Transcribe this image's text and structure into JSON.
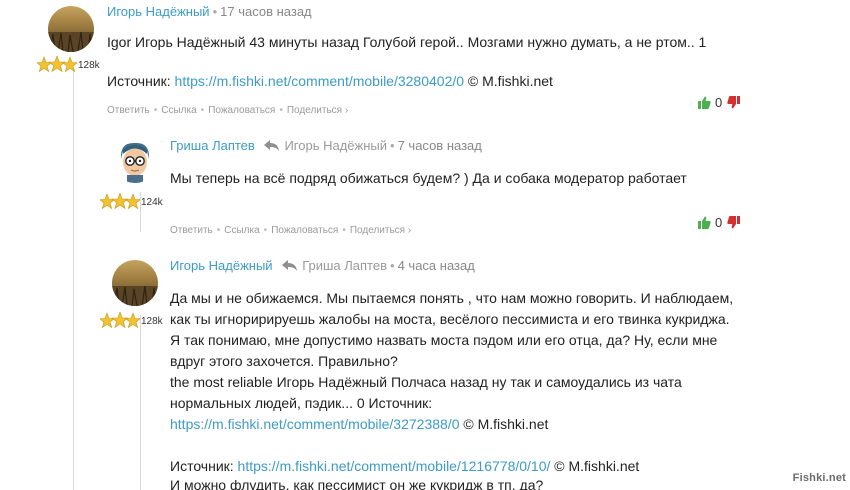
{
  "comments": [
    {
      "author": "Игорь Надёжный",
      "reply_to": "",
      "time": "17 часов назад",
      "karma": "128k",
      "lines": [
        "Igor Игорь Надёжный 43 минуты назад Голубой герой.. Мозгами нужно думать, а не ртом.. 1"
      ],
      "source_label": "Источник:",
      "source_url": "https://m.fishki.net/comment/mobile/3280402/0",
      "source_suffix": "© M.fishki.net",
      "actions": [
        "Ответить",
        "Ссылка",
        "Пожаловаться",
        "Поделиться ›"
      ],
      "score": "0"
    },
    {
      "author": "Гриша Лаптев",
      "reply_to": "Игорь Надёжный",
      "time": "7 часов назад",
      "karma": "124k",
      "lines": [
        "Мы теперь на всё подряд обижаться будем? ) Да и собака модератор работает"
      ],
      "actions": [
        "Ответить",
        "Ссылка",
        "Пожаловаться",
        "Поделиться ›"
      ],
      "score": "0"
    },
    {
      "author": "Игорь Надёжный",
      "reply_to": "Гриша Лаптев",
      "time": "4 часа назад",
      "karma": "128k",
      "lines": [
        "Да мы и не обижаемся. Мы пытаемся понять , что нам можно говорить. И наблюдаем,",
        "как ты игноририруешь жалобы на моста, весёлого пессимиста и его твинка кукриджа.",
        "Я так понимаю, мне допустимо назвать моста пэдом или его отца, да? Ну, если мне",
        "вдруг этого захочется. Правильно?",
        "the most reliable Игорь Надёжный Полчаса назад ну так и самоудались из чата",
        "нормальных людей, пэдик... 0 Источник:"
      ],
      "link1_url": "https://m.fishki.net/comment/mobile/3272388/0",
      "link1_suffix": "© M.fishki.net",
      "source_label": "Источник:",
      "source_url": "https://m.fishki.net/comment/mobile/1216778/0/10/",
      "source_suffix": "© M.fishki.net",
      "last_line": "И можно флудить, как пессимист он же кукридж в тп, да?"
    }
  ],
  "watermark": "Fishki.net",
  "colors": {
    "link": "#3d9bc6",
    "upvote": "#4caf50",
    "downvote": "#d32f2f",
    "star": "#f2c230"
  },
  "icons": {
    "upvote": "thumbs-up-icon",
    "downvote": "thumbs-down-icon",
    "reply": "reply-arrow-icon",
    "stars": "rank-stars-icon"
  }
}
